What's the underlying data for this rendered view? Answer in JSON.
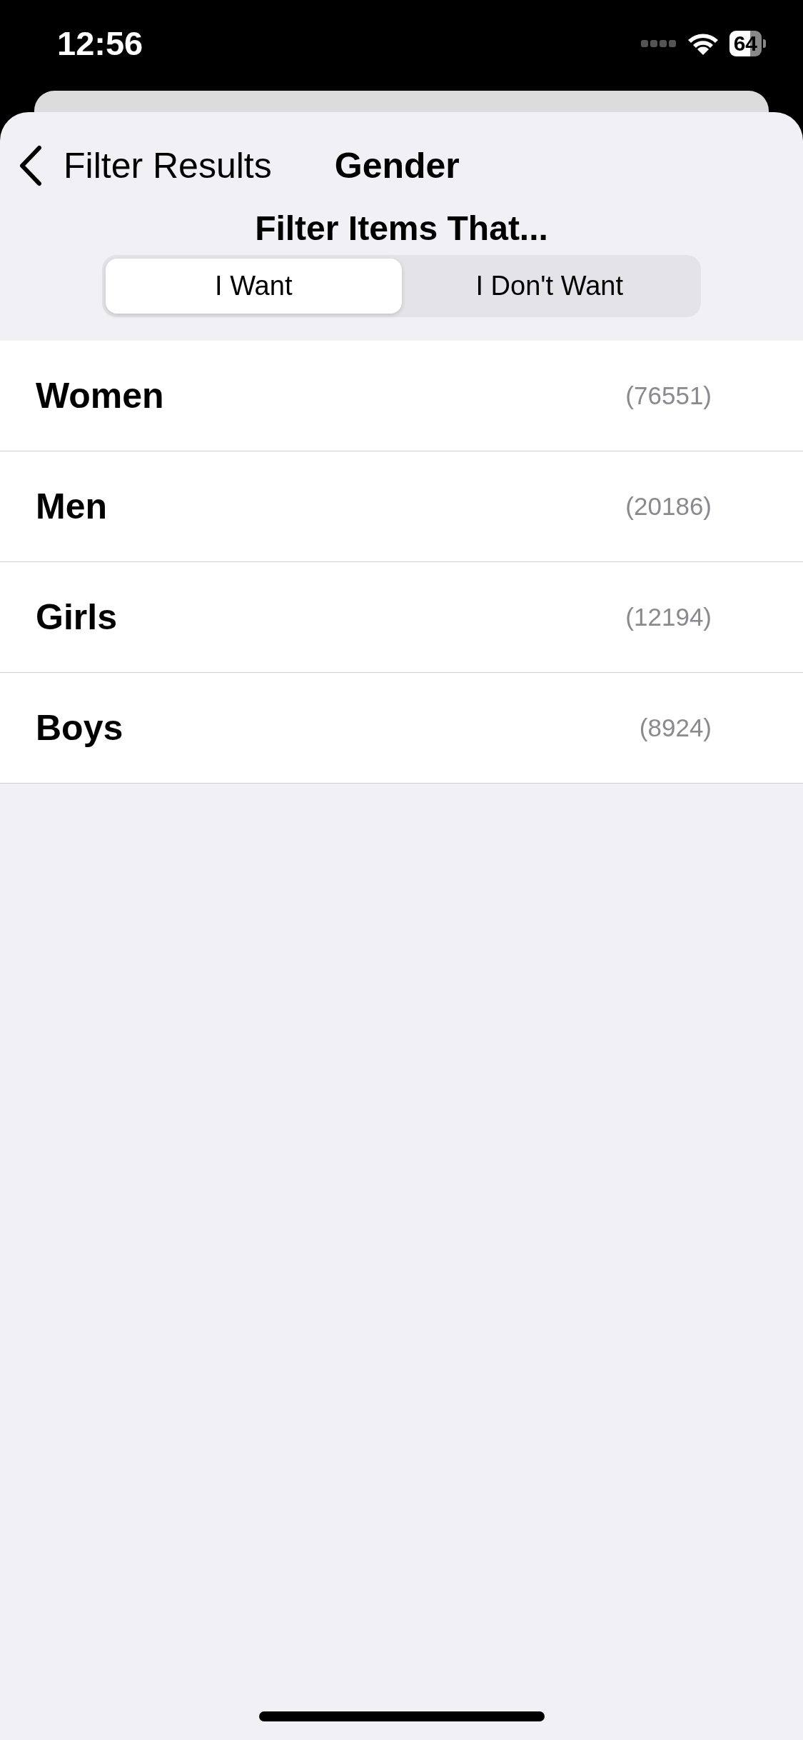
{
  "status_bar": {
    "time": "12:56",
    "battery": "64"
  },
  "nav": {
    "back_label": "Filter Results",
    "title": "Gender"
  },
  "filter": {
    "heading": "Filter Items That...",
    "segments": [
      {
        "label": "I Want",
        "selected": true
      },
      {
        "label": "I Don't Want",
        "selected": false
      }
    ]
  },
  "items": [
    {
      "name": "Women",
      "count": "(76551)"
    },
    {
      "name": "Men",
      "count": "(20186)"
    },
    {
      "name": "Girls",
      "count": "(12194)"
    },
    {
      "name": "Boys",
      "count": "(8924)"
    }
  ]
}
